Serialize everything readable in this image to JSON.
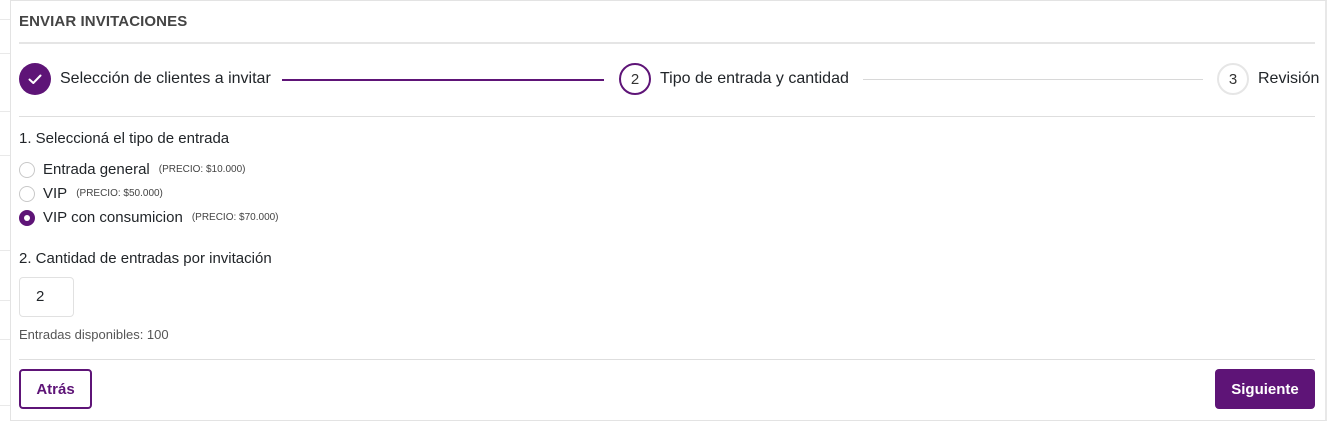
{
  "modal": {
    "title": "ENVIAR INVITACIONES"
  },
  "stepper": {
    "steps": [
      {
        "number": "1",
        "label": "Selección de clientes a invitar",
        "status": "completed"
      },
      {
        "number": "2",
        "label": "Tipo de entrada y cantidad",
        "status": "active"
      },
      {
        "number": "3",
        "label": "Revisión",
        "status": "pending"
      }
    ]
  },
  "ticket_type": {
    "title": "1. Seleccioná el tipo de entrada",
    "options": [
      {
        "label": "Entrada general",
        "price": "(PRECIO: $10.000)",
        "selected": false
      },
      {
        "label": "VIP",
        "price": "(PRECIO: $50.000)",
        "selected": false
      },
      {
        "label": "VIP con consumicion",
        "price": "(PRECIO: $70.000)",
        "selected": true
      }
    ]
  },
  "quantity": {
    "title": "2. Cantidad de entradas por invitación",
    "value": "2",
    "available_text": "Entradas disponibles: 100"
  },
  "footer": {
    "back_label": "Atrás",
    "next_label": "Siguiente"
  },
  "colors": {
    "accent": "#5e1477",
    "border": "#e1e1e1",
    "text": "#212529"
  },
  "icons": {
    "completed_step": "check-icon"
  }
}
